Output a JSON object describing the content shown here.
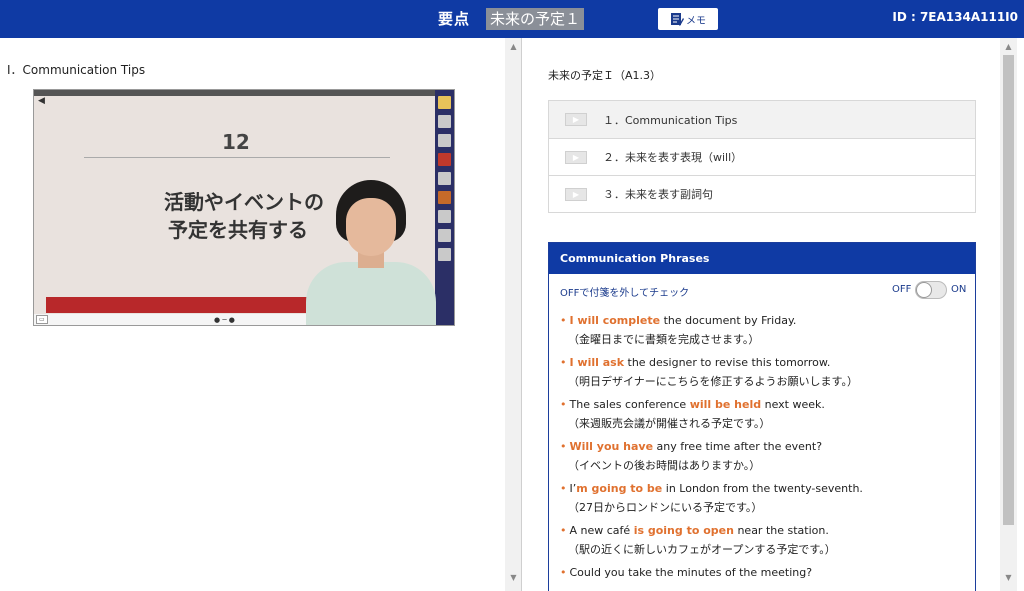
{
  "header": {
    "title": "要点",
    "lesson_chip": "未来の予定１",
    "memo_label": "メモ",
    "id_text": "ID : 7EA134A111I0",
    "bg_color": "#0f3aa4"
  },
  "left": {
    "section_heading": "I．Communication Tips",
    "video": {
      "slide_number": "12",
      "slide_line1": "活動やイベントの",
      "slide_line2": "予定を共有する"
    }
  },
  "right": {
    "lesson_title": "未来の予定Ｉ（A1.3）",
    "tips": [
      {
        "label": "１．Communication Tips"
      },
      {
        "label": "２．未来を表す表現（will）"
      },
      {
        "label": "３．未来を表す副詞句"
      }
    ],
    "phrases_box": {
      "title": "Communication Phrases",
      "toggle_desc": "OFFで付箋を外してチェック",
      "toggle_off_label": "OFF",
      "toggle_on_label": "ON",
      "items": [
        {
          "pre": "",
          "hl": "I will complete",
          "post": " the document by Friday.",
          "ja": "（金曜日までに書類を完成させます。）"
        },
        {
          "pre": "",
          "hl": "I will ask",
          "post": " the designer to revise this tomorrow.",
          "ja": "（明日デザイナーにこちらを修正するようお願いします。）"
        },
        {
          "pre": "The sales conference ",
          "hl": "will be held",
          "post": " next week.",
          "ja": "（来週販売会議が開催される予定です。）"
        },
        {
          "pre": "",
          "hl": "Will you have",
          "post": " any free time after the event?",
          "ja": "（イベントの後お時間はありますか。）"
        },
        {
          "pre": "I’",
          "hl": "m going to be",
          "post": " in London from the twenty-seventh.",
          "ja": "（27日からロンドンにいる予定です。）"
        },
        {
          "pre": "A new café ",
          "hl": "is going to open",
          "post": " near the station.",
          "ja": "（駅の近くに新しいカフェがオープンする予定です。）"
        },
        {
          "pre": "Could you take the minutes of the meeting?",
          "hl": "",
          "post": "",
          "ja": ""
        }
      ]
    }
  },
  "colors": {
    "accent": "#e0712f",
    "brand": "#0f3aa4"
  }
}
